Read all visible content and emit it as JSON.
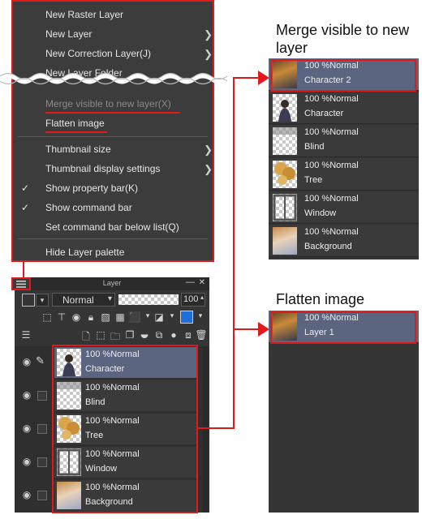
{
  "menu": {
    "items": [
      {
        "label": "New Raster Layer",
        "submenu": false
      },
      {
        "label": "New Layer",
        "submenu": true
      },
      {
        "label": "New Correction Layer(J)",
        "submenu": true
      },
      {
        "label": "New Layer Folder",
        "submenu": false
      }
    ],
    "merge_visible": "Merge visible to new layer(X)",
    "flatten": "Flatten image",
    "thumbnail_size": "Thumbnail size",
    "thumbnail_display": "Thumbnail display settings",
    "show_property_bar": "Show property bar(K)",
    "show_command_bar": "Show command bar",
    "set_command_bar": "Set command bar below list(Q)",
    "hide_layer_palette": "Hide Layer palette",
    "check_glyph": "✓"
  },
  "palette": {
    "title": "Layer",
    "blend_mode": "Normal",
    "opacity": "100",
    "layers": [
      {
        "mode": "100 %Normal",
        "name": "Character",
        "selected": true
      },
      {
        "mode": "100 %Normal",
        "name": "Blind",
        "selected": false
      },
      {
        "mode": "100 %Normal",
        "name": "Tree",
        "selected": false
      },
      {
        "mode": "100 %Normal",
        "name": "Window",
        "selected": false
      },
      {
        "mode": "100 %Normal",
        "name": "Background",
        "selected": false
      }
    ]
  },
  "merge_result": {
    "heading": "Merge visible to new layer",
    "layers": [
      {
        "mode": "100 %Normal",
        "name": "Character 2",
        "selected": true
      },
      {
        "mode": "100 %Normal",
        "name": "Character",
        "selected": false
      },
      {
        "mode": "100 %Normal",
        "name": "Blind",
        "selected": false
      },
      {
        "mode": "100 %Normal",
        "name": "Tree",
        "selected": false
      },
      {
        "mode": "100 %Normal",
        "name": "Window",
        "selected": false
      },
      {
        "mode": "100 %Normal",
        "name": "Background",
        "selected": false
      }
    ]
  },
  "flatten_result": {
    "heading": "Flatten image",
    "layers": [
      {
        "mode": "100 %Normal",
        "name": "Layer 1",
        "selected": true
      }
    ]
  },
  "colors": {
    "highlight_red": "#e01a1a",
    "panel_bg": "#353535",
    "selected_row": "#5b6580"
  }
}
